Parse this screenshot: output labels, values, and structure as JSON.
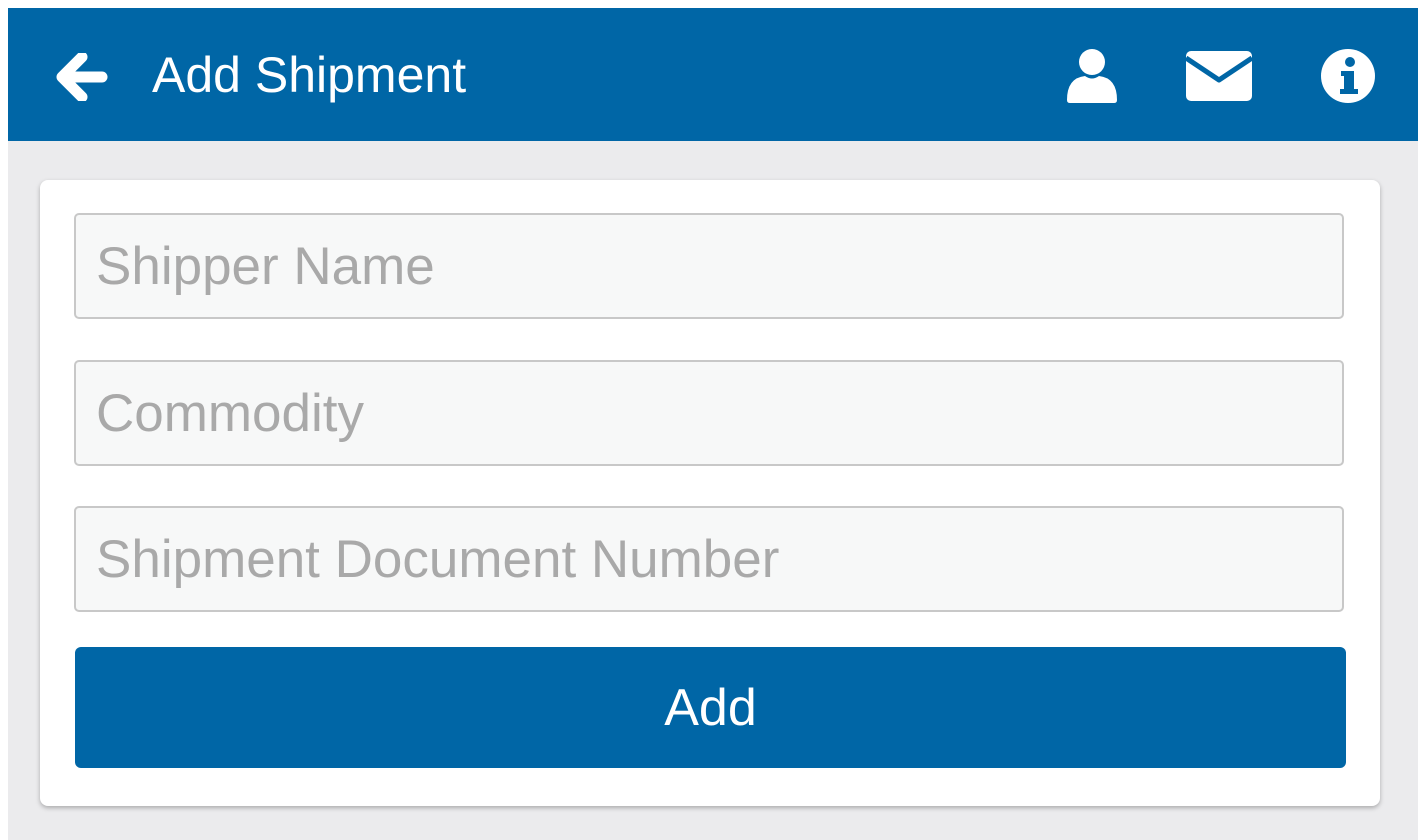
{
  "header": {
    "title": "Add Shipment",
    "back_icon": "arrow-left-icon",
    "actions": [
      {
        "name": "user-icon"
      },
      {
        "name": "envelope-icon"
      },
      {
        "name": "info-icon"
      }
    ],
    "background": "#0066a6"
  },
  "form": {
    "fields": [
      {
        "placeholder": "Shipper Name",
        "value": ""
      },
      {
        "placeholder": "Commodity",
        "value": ""
      },
      {
        "placeholder": "Shipment Document Number",
        "value": ""
      }
    ],
    "submit_label": "Add"
  },
  "colors": {
    "primary": "#0066a6",
    "page_background": "#ebebed",
    "placeholder_text": "#a9a9a9"
  }
}
